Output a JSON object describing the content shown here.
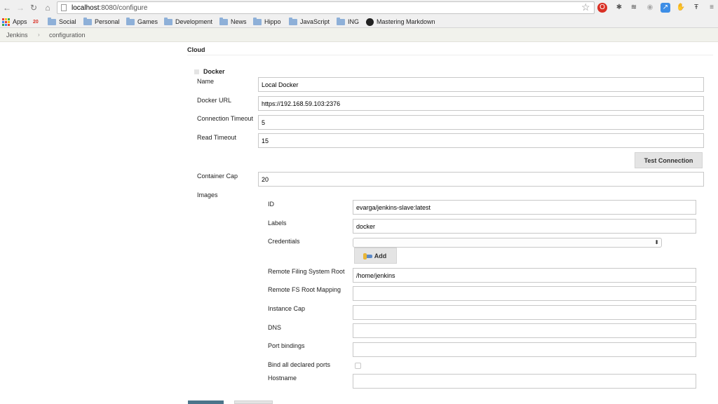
{
  "browser": {
    "url_host": "localhost",
    "url_path": ":8080/configure",
    "icons": [
      "back-icon",
      "forward-icon",
      "reload-icon",
      "home-icon",
      "bookmark-star-icon"
    ]
  },
  "bookmarks": {
    "apps": "Apps",
    "gmail_badge": "20",
    "items": [
      "Social",
      "Personal",
      "Games",
      "Development",
      "News",
      "Hippo",
      "JavaScript",
      "ING",
      "Mastering Markdown"
    ]
  },
  "breadcrumb": {
    "root": "Jenkins",
    "sep": "›",
    "current": "configuration"
  },
  "cloud": {
    "section_title": "Cloud",
    "name": "Docker",
    "fields": {
      "name": {
        "label": "Name",
        "value": "Local Docker"
      },
      "docker_url": {
        "label": "Docker URL",
        "value": "https://192.168.59.103:2376"
      },
      "connection_timeout": {
        "label": "Connection Timeout",
        "value": "5"
      },
      "read_timeout": {
        "label": "Read Timeout",
        "value": "15"
      },
      "container_cap": {
        "label": "Container Cap",
        "value": "20"
      }
    },
    "test_connection": "Test Connection",
    "images_label": "Images"
  },
  "image": {
    "id": {
      "label": "ID",
      "value": "evarga/jenkins-slave:latest"
    },
    "labels": {
      "label": "Labels",
      "value": "docker"
    },
    "credentials": {
      "label": "Credentials",
      "value": ""
    },
    "add_button": "Add",
    "remote_fs_root": {
      "label": "Remote Filing System Root",
      "value": "/home/jenkins"
    },
    "remote_fs_mapping": {
      "label": "Remote FS Root Mapping",
      "value": ""
    },
    "instance_cap": {
      "label": "Instance Cap",
      "value": ""
    },
    "dns": {
      "label": "DNS",
      "value": ""
    },
    "port_bindings": {
      "label": "Port bindings",
      "value": ""
    },
    "bind_all_ports": {
      "label": "Bind all declared ports",
      "checked": false
    },
    "hostname": {
      "label": "Hostname",
      "value": ""
    }
  },
  "colors": {
    "primary_button": "#4b758b",
    "breadcrumb_bg": "#f1f2ec"
  }
}
